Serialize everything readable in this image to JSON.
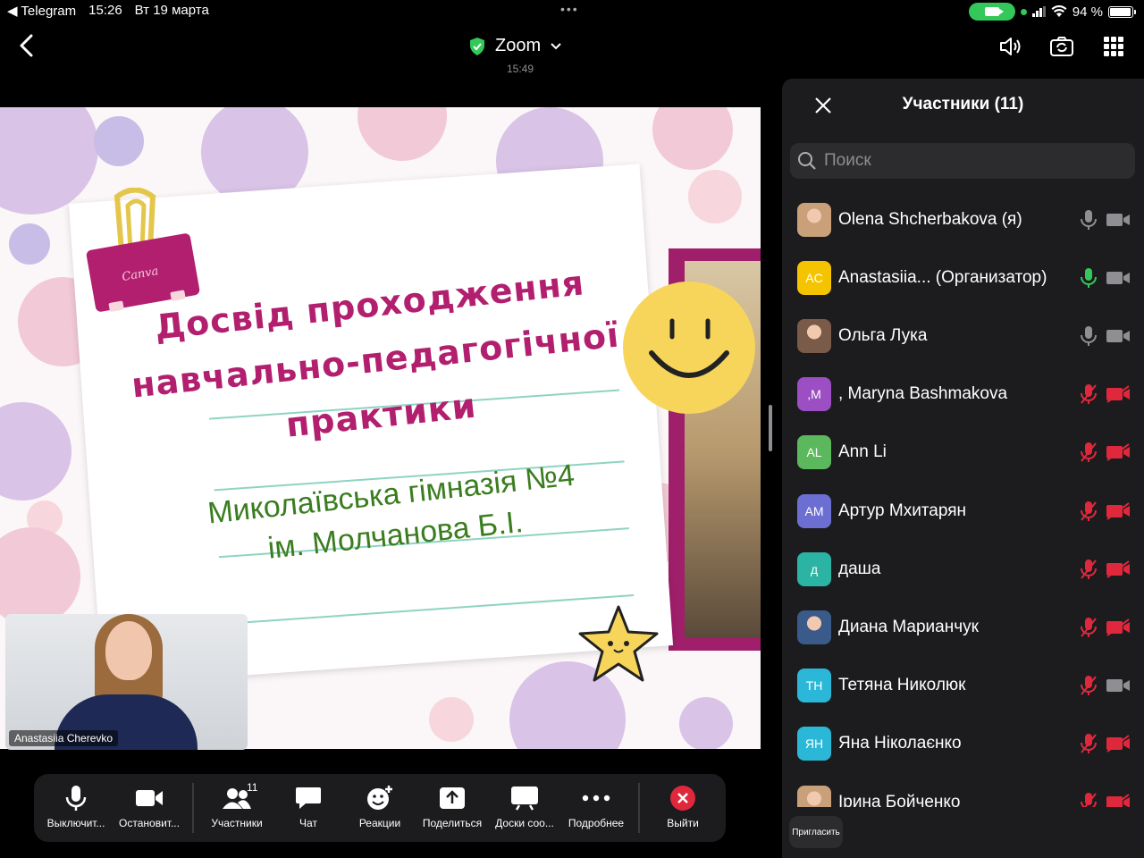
{
  "status_bar": {
    "back_app": "◀ Telegram",
    "time": "15:26",
    "date": "Вт 19 марта",
    "battery": "94 %",
    "battery_level": 0.94
  },
  "header": {
    "title": "Zoom",
    "meeting_time": "15:49",
    "icons": [
      "back-chevron-icon",
      "shield-check-icon",
      "chevron-down-icon",
      "speaker-icon",
      "camera-switch-icon",
      "grid-view-icon"
    ]
  },
  "slide": {
    "heading_lines": [
      "Досвід проходження",
      "навчально-педагогічної",
      "практики"
    ],
    "school_lines": [
      "Миколаївська гімназія №4",
      "ім. Молчанова Б.І."
    ],
    "clip_label": "Canva",
    "colors": {
      "heading": "#b21f6f",
      "school": "#3a7d1f",
      "rule": "#8fd3c3"
    }
  },
  "self_view": {
    "name": "Anastasiia Cherevko"
  },
  "toolbar": {
    "mute": "Выключит...",
    "stop_video": "Остановит...",
    "participants": "Участники",
    "participants_count": "11",
    "chat": "Чат",
    "reactions": "Реакции",
    "share": "Поделиться",
    "whiteboards": "Доски соо...",
    "more": "Подробнее",
    "leave": "Выйти"
  },
  "panel": {
    "title": "Участники (11)",
    "search_placeholder": "Поиск",
    "invite": "Пригласить",
    "participants": [
      {
        "name": "Olena Shcherbakova (я)",
        "avatar": "",
        "avatar_color": "#c9a07a",
        "photo": true,
        "mic": "on",
        "cam": "on"
      },
      {
        "name": "Anastasiia...    (Организатор)",
        "avatar": "AC",
        "avatar_color": "#f5c400",
        "photo": false,
        "mic": "active",
        "cam": "on"
      },
      {
        "name": "Ольга Лука",
        "avatar": "",
        "avatar_color": "#7a5a48",
        "photo": true,
        "mic": "on",
        "cam": "on"
      },
      {
        "name": ", Maryna Bashmakova",
        "avatar": ",M",
        "avatar_color": "#9b4fc2",
        "photo": false,
        "mic": "muted",
        "cam": "off"
      },
      {
        "name": "Ann Li",
        "avatar": "AL",
        "avatar_color": "#5cb85c",
        "photo": false,
        "mic": "muted",
        "cam": "off"
      },
      {
        "name": "Артур Мхитарян",
        "avatar": "AM",
        "avatar_color": "#6c6fd1",
        "photo": false,
        "mic": "muted",
        "cam": "off"
      },
      {
        "name": "даша",
        "avatar": "д",
        "avatar_color": "#2bb3a3",
        "photo": false,
        "mic": "muted",
        "cam": "off"
      },
      {
        "name": "Диана Марианчук",
        "avatar": "",
        "avatar_color": "#3a5a8a",
        "photo": true,
        "mic": "muted",
        "cam": "off"
      },
      {
        "name": "Тетяна Николюк",
        "avatar": "ТН",
        "avatar_color": "#2bb8d8",
        "photo": false,
        "mic": "muted",
        "cam": "on"
      },
      {
        "name": "Яна Ніколаєнко",
        "avatar": "ЯН",
        "avatar_color": "#2bb8d8",
        "photo": false,
        "mic": "muted",
        "cam": "off"
      },
      {
        "name": "Ірина Бойченко",
        "avatar": "",
        "avatar_color": "#c9a07a",
        "photo": true,
        "mic": "muted",
        "cam": "off"
      }
    ]
  }
}
